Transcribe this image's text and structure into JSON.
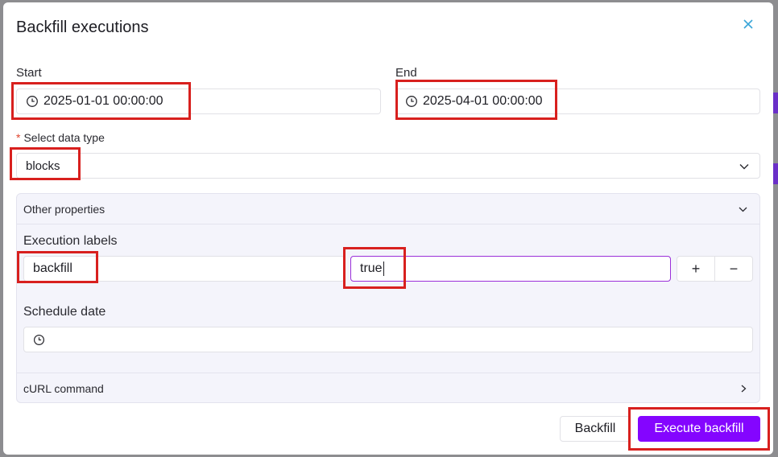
{
  "dialog": {
    "title": "Backfill executions",
    "close_icon": "close-icon"
  },
  "start": {
    "label": "Start",
    "value": "2025-01-01 00:00:00",
    "icon": "clock-icon"
  },
  "end": {
    "label": "End",
    "value": "2025-04-01 00:00:00",
    "icon": "clock-icon"
  },
  "data_type": {
    "required_mark": "*",
    "label": "Select data type",
    "value": "blocks",
    "icon": "chevron-down-icon"
  },
  "other_properties": {
    "title": "Other properties",
    "execution_labels": {
      "label": "Execution labels",
      "key": "backfill",
      "value": "true"
    },
    "add_label": "+",
    "remove_label": "−",
    "schedule_date": {
      "label": "Schedule date",
      "value": ""
    },
    "curl": {
      "label": "cURL command"
    }
  },
  "actions": {
    "backfill": "Backfill",
    "execute": "Execute backfill"
  },
  "colors": {
    "accent": "#8405ff",
    "highlight": "#d8201e"
  }
}
